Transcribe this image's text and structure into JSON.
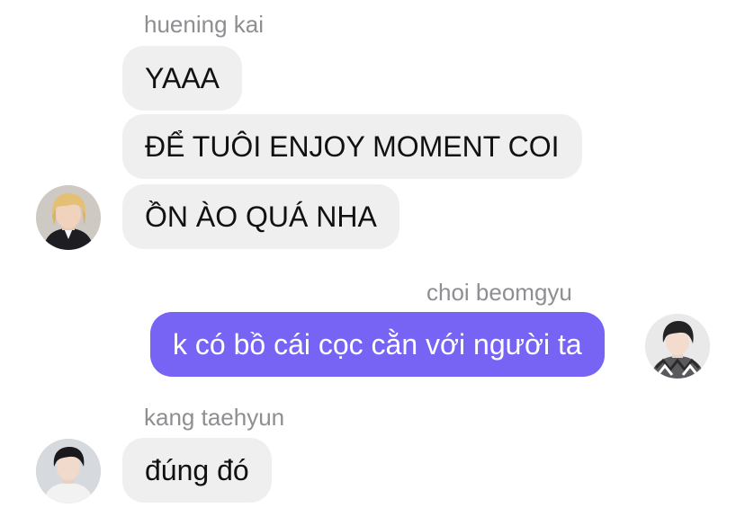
{
  "groups": [
    {
      "sender": "huening kai",
      "avatar_icon": "blonde-boy-avatar-icon",
      "messages": [
        "YAAA",
        "ĐỂ TUÔI ENJOY MOMENT COI",
        "ỒN ÀO QUÁ NHA"
      ]
    },
    {
      "sender": "choi beomgyu",
      "avatar_icon": "dark-hair-boy-avatar-icon",
      "messages": [
        "k có bồ cái cọc cằn với người ta"
      ]
    },
    {
      "sender": "kang taehyun",
      "avatar_icon": "dark-hair-boy-avatar-icon",
      "messages": [
        "đúng đó"
      ]
    }
  ],
  "colors": {
    "incoming_bubble": "#efefef",
    "outgoing_bubble": "#7763f4",
    "sender_name": "#8e8e93"
  }
}
